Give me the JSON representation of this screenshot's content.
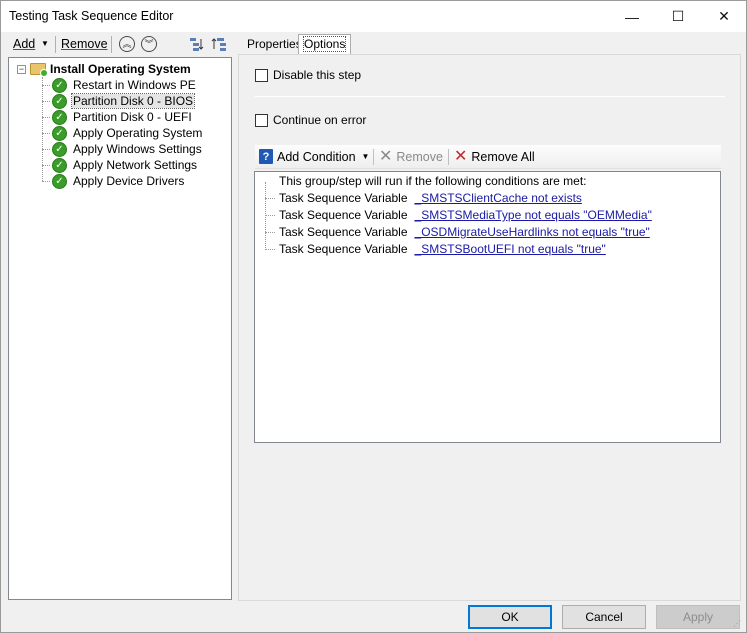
{
  "window": {
    "title": "Testing Task Sequence Editor",
    "minimize_glyph": "—",
    "maximize_glyph": "☐",
    "close_glyph": "✕"
  },
  "toolbar": {
    "add_label": "Add",
    "remove_label": "Remove",
    "move_up_icon": "move-up-icon",
    "move_down_icon": "move-down-icon"
  },
  "tree": {
    "root_label": "Install Operating System",
    "items": [
      {
        "label": "Restart in Windows PE"
      },
      {
        "label": "Partition Disk 0 - BIOS"
      },
      {
        "label": "Partition Disk 0 - UEFI"
      },
      {
        "label": "Apply Operating System"
      },
      {
        "label": "Apply Windows Settings"
      },
      {
        "label": "Apply Network Settings"
      },
      {
        "label": "Apply Device Drivers"
      }
    ],
    "selected_index": 1
  },
  "tabs": [
    {
      "label": "Properties"
    },
    {
      "label": "Options"
    }
  ],
  "active_tab": 1,
  "options": {
    "disable_step_label": "Disable this step",
    "continue_on_error_label": "Continue on error",
    "add_condition_label": "Add Condition",
    "remove_label": "Remove",
    "remove_all_label": "Remove All",
    "conditions_header": "This group/step will run if the following conditions are met:",
    "conditions": [
      {
        "type": "Task Sequence Variable",
        "expression": "_SMSTSClientCache not exists"
      },
      {
        "type": "Task Sequence Variable",
        "expression": "_SMSTSMediaType not equals \"OEMMedia\""
      },
      {
        "type": "Task Sequence Variable",
        "expression": "_OSDMigrateUseHardlinks not equals \"true\""
      },
      {
        "type": "Task Sequence Variable",
        "expression": "_SMSTSBootUEFI not equals \"true\""
      }
    ]
  },
  "buttons": {
    "ok": "OK",
    "cancel": "Cancel",
    "apply": "Apply"
  },
  "colors": {
    "link": "#1a1aa6",
    "focus_border": "#0078d7",
    "success_green": "#3a9d2a"
  }
}
